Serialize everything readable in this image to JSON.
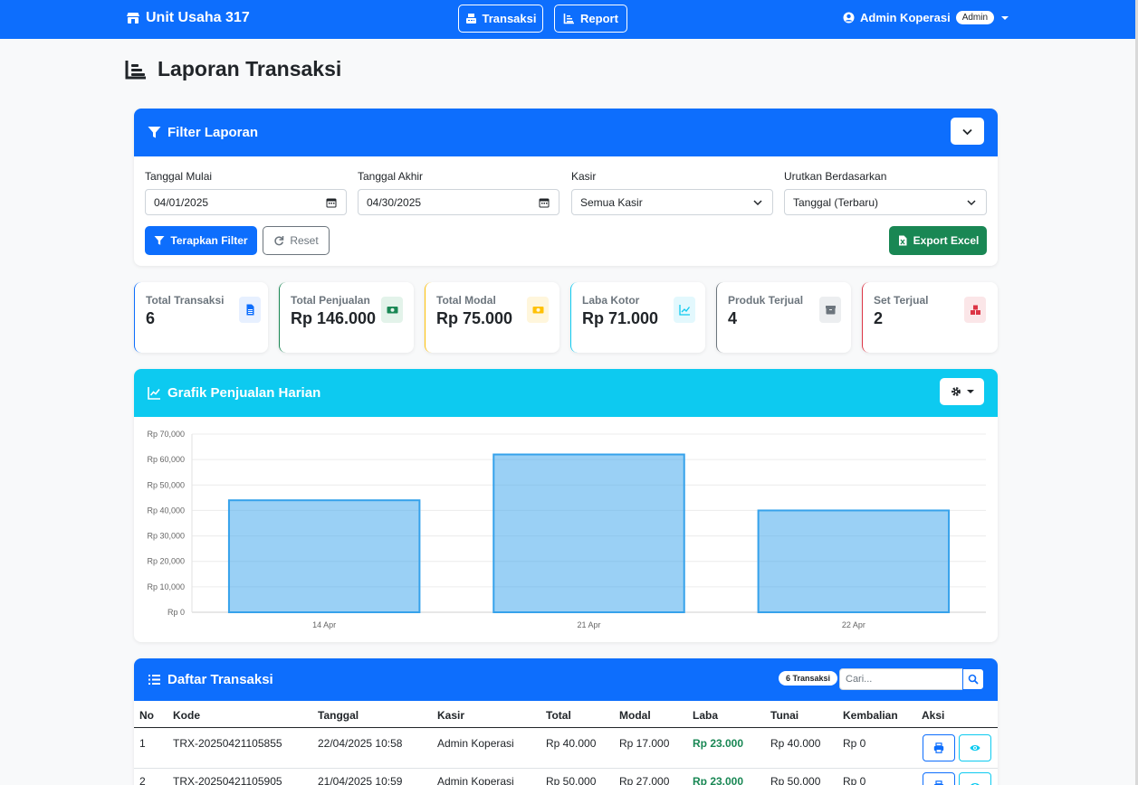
{
  "colors": {
    "primary": "#0d6efd",
    "info": "#0dcaf0",
    "success": "#198754",
    "warning": "#ffc107",
    "danger": "#dc3545",
    "secondary": "#6c757d"
  },
  "navbar": {
    "brand": "Unit Usaha 317",
    "buttons": [
      {
        "label": "Transaksi",
        "icon": "cash-register-icon"
      },
      {
        "label": "Report",
        "icon": "chart-line-icon"
      }
    ],
    "user": {
      "name": "Admin Koperasi",
      "role": "Admin",
      "icon": "user-circle-icon"
    }
  },
  "page": {
    "title": "Laporan Transaksi",
    "icon": "chart-bars-icon"
  },
  "filter": {
    "title": "Filter Laporan",
    "fields": [
      {
        "label": "Tanggal Mulai",
        "value": "04/01/2025",
        "kind": "date"
      },
      {
        "label": "Tanggal Akhir",
        "value": "04/30/2025",
        "kind": "date"
      },
      {
        "label": "Kasir",
        "value": "Semua Kasir",
        "kind": "select"
      },
      {
        "label": "Urutkan Berdasarkan",
        "value": "Tanggal (Terbaru)",
        "kind": "select"
      }
    ],
    "apply_label": "Terapkan Filter",
    "reset_label": "Reset",
    "export_label": "Export Excel"
  },
  "stats": [
    {
      "label": "Total Transaksi",
      "value": "6",
      "icon": "file-icon",
      "color": "#0d6efd"
    },
    {
      "label": "Total Penjualan",
      "value": "Rp 146.000",
      "icon": "money-bill-icon",
      "color": "#198754"
    },
    {
      "label": "Total Modal",
      "value": "Rp 75.000",
      "icon": "coins-icon",
      "color": "#ffc107"
    },
    {
      "label": "Laba Kotor",
      "value": "Rp 71.000",
      "icon": "chart-line-icon",
      "color": "#0dcaf0"
    },
    {
      "label": "Produk Terjual",
      "value": "4",
      "icon": "box-icon",
      "color": "#6c757d"
    },
    {
      "label": "Set Terjual",
      "value": "2",
      "icon": "boxes-icon",
      "color": "#dc3545"
    }
  ],
  "chart_section": {
    "title": "Grafik Penjualan Harian",
    "icon": "chart-area-icon"
  },
  "chart_data": {
    "type": "bar",
    "categories": [
      "14 Apr",
      "21 Apr",
      "22 Apr"
    ],
    "values": [
      44000,
      62000,
      40000
    ],
    "ylim": [
      0,
      70000
    ],
    "yticks": [
      "Rp 0",
      "Rp 10,000",
      "Rp 20,000",
      "Rp 30,000",
      "Rp 40,000",
      "Rp 50,000",
      "Rp 60,000",
      "Rp 70,000"
    ],
    "bar_color": "#36a2eb",
    "grid": true,
    "title": "",
    "xlabel": "",
    "ylabel": ""
  },
  "table": {
    "title": "Daftar Transaksi",
    "count_badge": "6 Transaksi",
    "search_placeholder": "Cari...",
    "headers": [
      "No",
      "Kode",
      "Tanggal",
      "Kasir",
      "Total",
      "Modal",
      "Laba",
      "Tunai",
      "Kembalian",
      "Aksi"
    ],
    "rows": [
      [
        "1",
        "TRX-20250421105855",
        "22/04/2025 10:58",
        "Admin Koperasi",
        "Rp 40.000",
        "Rp 17.000",
        "Rp 23.000",
        "Rp 40.000",
        "Rp 0"
      ],
      [
        "2",
        "TRX-20250421105905",
        "21/04/2025 10:59",
        "Admin Koperasi",
        "Rp 50.000",
        "Rp 27.000",
        "Rp 23.000",
        "Rp 50.000",
        "Rp 0"
      ]
    ]
  }
}
